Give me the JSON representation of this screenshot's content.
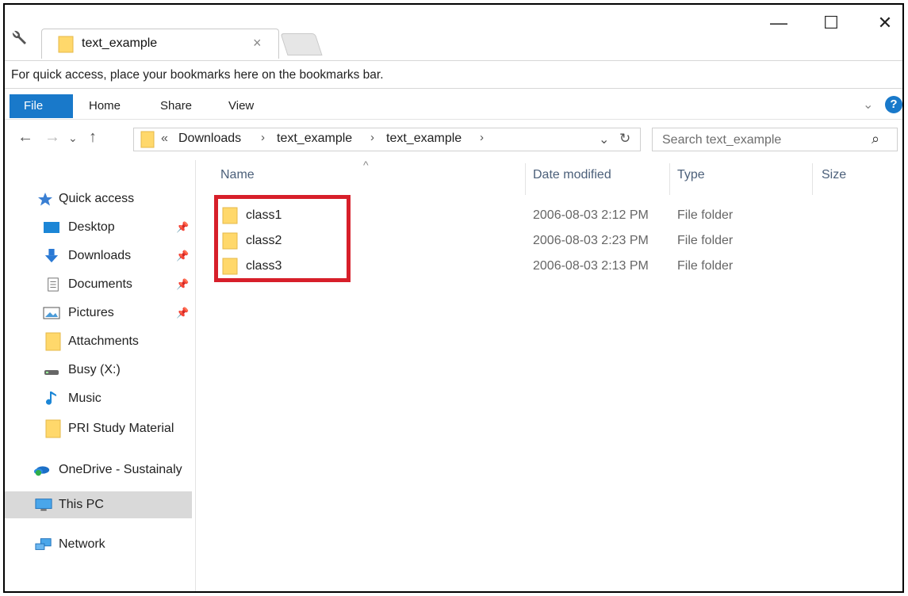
{
  "window": {
    "tab_title": "text_example",
    "close_tab_glyph": "×",
    "min_glyph": "—",
    "max_glyph": "☐",
    "close_glyph": "✕"
  },
  "bookmarks_bar": {
    "message": "For quick access, place your bookmarks here on the bookmarks bar."
  },
  "ribbon": {
    "tabs": [
      {
        "label": "File"
      },
      {
        "label": "Home"
      },
      {
        "label": "Share"
      },
      {
        "label": "View"
      }
    ],
    "help_label": "?"
  },
  "address": {
    "overflow": "«",
    "crumbs": [
      "Downloads",
      "text_example",
      "text_example"
    ],
    "sep": "›"
  },
  "search": {
    "placeholder": "Search text_example"
  },
  "sidebar": {
    "items": [
      {
        "label": "Quick access",
        "icon": "star-icon",
        "pinned": false
      },
      {
        "label": "Desktop",
        "icon": "desktop-icon",
        "pinned": true
      },
      {
        "label": "Downloads",
        "icon": "download-arrow-icon",
        "pinned": true
      },
      {
        "label": "Documents",
        "icon": "document-icon",
        "pinned": true
      },
      {
        "label": "Pictures",
        "icon": "pictures-icon",
        "pinned": true
      },
      {
        "label": "Attachments",
        "icon": "folder-icon",
        "pinned": false
      },
      {
        "label": "Busy (X:)",
        "icon": "drive-icon",
        "pinned": false
      },
      {
        "label": "Music",
        "icon": "music-note-icon",
        "pinned": false
      },
      {
        "label": "PRI Study Material",
        "icon": "folder-icon",
        "pinned": false
      },
      {
        "label": "OneDrive - Sustainaly",
        "icon": "onedrive-icon",
        "pinned": false
      },
      {
        "label": "This PC",
        "icon": "this-pc-icon",
        "pinned": false,
        "selected": true
      },
      {
        "label": "Network",
        "icon": "network-icon",
        "pinned": false
      }
    ]
  },
  "filelist": {
    "columns": {
      "name": "Name",
      "date": "Date modified",
      "type": "Type",
      "size": "Size"
    },
    "rows": [
      {
        "name": "class1",
        "date": "2006-08-03 2:12 PM",
        "type": "File folder"
      },
      {
        "name": "class2",
        "date": "2006-08-03 2:23 PM",
        "type": "File folder"
      },
      {
        "name": "class3",
        "date": "2006-08-03 2:13 PM",
        "type": "File folder"
      }
    ]
  },
  "colors": {
    "accent": "#1979ca",
    "highlight": "#d71f2a",
    "folder": "#ffd86b"
  }
}
